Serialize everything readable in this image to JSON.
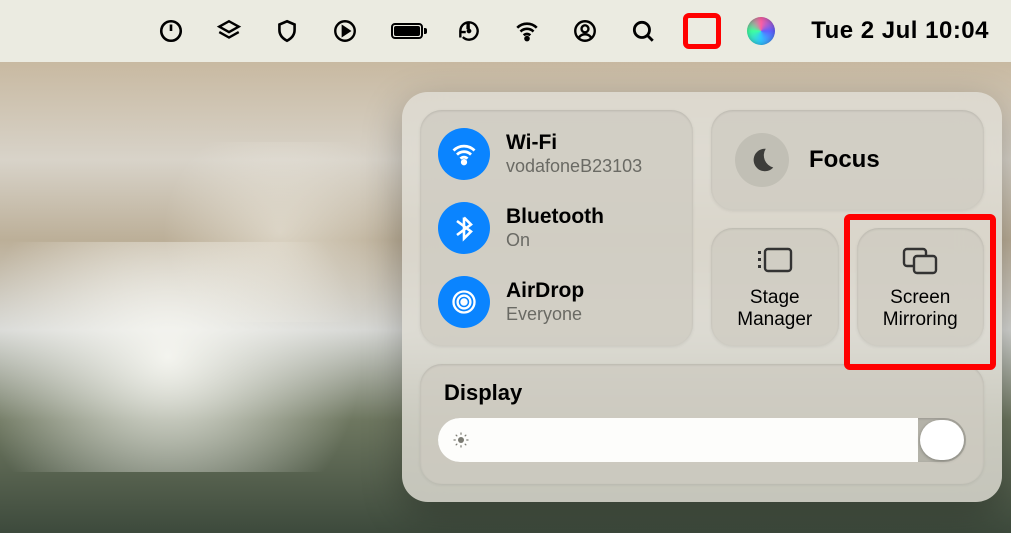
{
  "menubar": {
    "clock": "Tue 2 Jul  10:04"
  },
  "controlCenter": {
    "wifi": {
      "title": "Wi-Fi",
      "status": "vodafoneB23103"
    },
    "bluetooth": {
      "title": "Bluetooth",
      "status": "On"
    },
    "airdrop": {
      "title": "AirDrop",
      "status": "Everyone"
    },
    "focus": {
      "title": "Focus"
    },
    "stageManager": {
      "line1": "Stage",
      "line2": "Manager"
    },
    "screenMirroring": {
      "line1": "Screen",
      "line2": "Mirroring"
    },
    "display": {
      "title": "Display"
    }
  }
}
